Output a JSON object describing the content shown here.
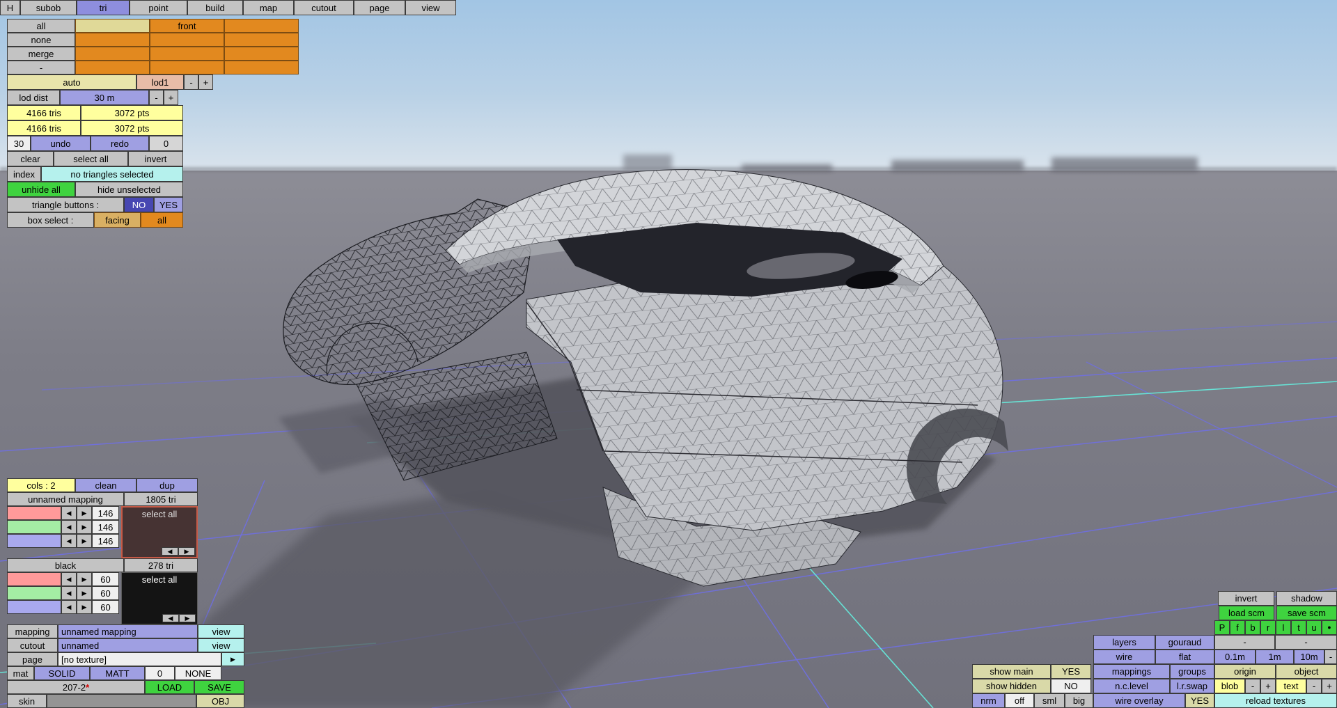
{
  "colors": {
    "periwinkle": "#9f9fe2",
    "periwinkle_dark": "#4747b2",
    "orange": "#e2891f",
    "khaki": "#e9e5ab",
    "yellow": "#ffff9e",
    "beige": "#d9d9a8",
    "green": "#3fd33f",
    "cyan": "#b5f1ed",
    "tan": "#d9b063",
    "pink": "#e7bca8",
    "swatch_red": "#ff9a9a",
    "swatch_green": "#a4eda4",
    "swatch_blue": "#a9a9ee",
    "sky": "#aac9e5",
    "ground": "#7c7c86",
    "grid_blue": "#6f6fe2",
    "grid_cyan": "#66e8da"
  },
  "menubar": {
    "items": [
      "H",
      "subob",
      "tri",
      "point",
      "build",
      "map",
      "cutout",
      "page",
      "view"
    ],
    "active": "tri"
  },
  "topleft": {
    "grid_rows": [
      "all",
      "none",
      "merge",
      "-"
    ],
    "front": "front",
    "auto": "auto",
    "lod1": "lod1",
    "minus": "-",
    "plus": "+",
    "lod_dist_label": "lod dist",
    "lod_dist_value": "30 m",
    "tris": "4166 tris",
    "pts": "3072 pts",
    "undo_count": "30",
    "undo": "undo",
    "redo": "redo",
    "redo_count": "0",
    "clear": "clear",
    "select_all": "select all",
    "invert": "invert",
    "index": "index",
    "index_status": "no triangles selected",
    "unhide_all": "unhide all",
    "hide_unselected": "hide unselected",
    "triangle_buttons_label": "triangle buttons :",
    "no": "NO",
    "yes": "YES",
    "box_select_label": "box select :",
    "facing": "facing",
    "all": "all"
  },
  "mapping_panel": {
    "cols": "cols : 2",
    "clean": "clean",
    "dup": "dup",
    "prev": "◀",
    "next": "▶",
    "groups": [
      {
        "name": "unnamed mapping",
        "tris": "1805 tri",
        "select_all": "select all",
        "values": [
          "146",
          "146",
          "146"
        ]
      },
      {
        "name": "black",
        "tris": "278 tri",
        "select_all": "select all",
        "values": [
          "60",
          "60",
          "60"
        ]
      }
    ],
    "mapping_label": "mapping",
    "mapping_value": "unnamed mapping",
    "mapping_action": "view",
    "cutout_label": "cutout",
    "cutout_value": "unnamed",
    "cutout_action": "view",
    "page_label": "page",
    "page_value": "[no texture]",
    "page_action": "▶",
    "mat_label": "mat",
    "mat_solid": "SOLID",
    "mat_matt": "MATT",
    "mat_num": "0",
    "mat_none": "NONE",
    "file_name": "207-2",
    "file_flag": "*",
    "load": "LOAD",
    "save": "SAVE",
    "skin_label": "skin",
    "obj": "OBJ"
  },
  "rightpanel": {
    "invert": "invert",
    "shadow": "shadow",
    "load_scm": "load scm",
    "save_scm": "save scm",
    "views": [
      "P",
      "f",
      "b",
      "r",
      "l",
      "t",
      "u",
      "●"
    ],
    "layers": "layers",
    "gouraud": "gouraud",
    "dash1": "-",
    "dash2": "-",
    "wire": "wire",
    "flat": "flat",
    "m01": "0.1m",
    "m1": "1m",
    "m10": "10m",
    "dash3": "-",
    "show_main": "show main",
    "show_main_value": "YES",
    "mappings": "mappings",
    "groups": "groups",
    "origin": "origin",
    "object": "object",
    "show_hidden": "show hidden",
    "show_hidden_value": "NO",
    "nc_level": "n.c.level",
    "lr_swap": "l.r.swap",
    "blob": "blob",
    "blob_minus": "-",
    "blob_plus": "+",
    "text": "text",
    "text_minus": "-",
    "text_plus": "+",
    "nrm": "nrm",
    "off": "off",
    "sml": "sml",
    "big": "big",
    "wire_overlay": "wire overlay",
    "overlay_value": "YES",
    "reload_textures": "reload textures"
  }
}
